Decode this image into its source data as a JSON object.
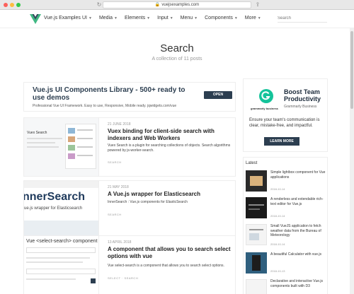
{
  "browser": {
    "url": "vuejsexamples.com"
  },
  "nav": {
    "brand": "Vue.js Examples",
    "items": [
      "UI",
      "Media",
      "Elements",
      "Input",
      "Menu",
      "Components",
      "More"
    ],
    "search_placeholder": "Search"
  },
  "header": {
    "title": "Search",
    "subtitle": "A collection of 11 posts"
  },
  "ad_banner": {
    "title": "Vue.js UI Components Library - 500+ ready to use demos",
    "description": "Professional Vue UI Framework. Easy to use, Responsive, Mobile ready. jqwidgets.com/vue",
    "button": "OPEN"
  },
  "posts": [
    {
      "date": "21 JUNE 2018",
      "title": "Vuex binding for client-side search with indexers and Web Workers",
      "excerpt": "Vuex Search is a plugin for searching collections of objects. Search algorithms powered by js-worker-search.",
      "tag": "SEARCH",
      "thumb_text": "Vuex Search"
    },
    {
      "date": "21 MAY 2018",
      "title": "A Vue.js wrapper for Elasticsearch",
      "excerpt": "InnerSearch : Vue.js components for ElasticSearch",
      "tag": "SEARCH",
      "thumb_title": "nnerSearch",
      "thumb_sub": "ue.js wrapper for Elasticsearch"
    },
    {
      "date": "13 APRIL 2018",
      "title": "A component that allows you to search select options with vue",
      "excerpt": "Vue select-search is a component that allows you to search select options.",
      "tag": "SELECT · SEARCH",
      "thumb_title": "Vue <select-search> component"
    }
  ],
  "side_ad": {
    "logo_word": "grammarly business",
    "title": "Boost Team Productivity",
    "brand": "Grammarly Business",
    "text": "Ensure your team's communication is clear, mistake-free, and impactful.",
    "button": "LEARN MORE"
  },
  "latest": {
    "heading": "Latest",
    "items": [
      {
        "title": "Simple lightbox component for Vue applications",
        "date": "2018-10-14"
      },
      {
        "title": "A renderless and extendable rich-text editor for Vue.js",
        "date": "2018-10-14"
      },
      {
        "title": "Small VueJS application to fetch weather data from the Bureau of Meteorology",
        "date": "2018-10-14"
      },
      {
        "title": "A beautiful Calculator with vue.js",
        "date": "2018-10-13"
      },
      {
        "title": "Declarative and interactive Vue.js components built with D3",
        "date": ""
      }
    ]
  },
  "colors": {
    "vue_green": "#41b883",
    "vue_dark": "#35495e",
    "grammarly": "#15c39a",
    "button_dark": "#2c3e50"
  }
}
